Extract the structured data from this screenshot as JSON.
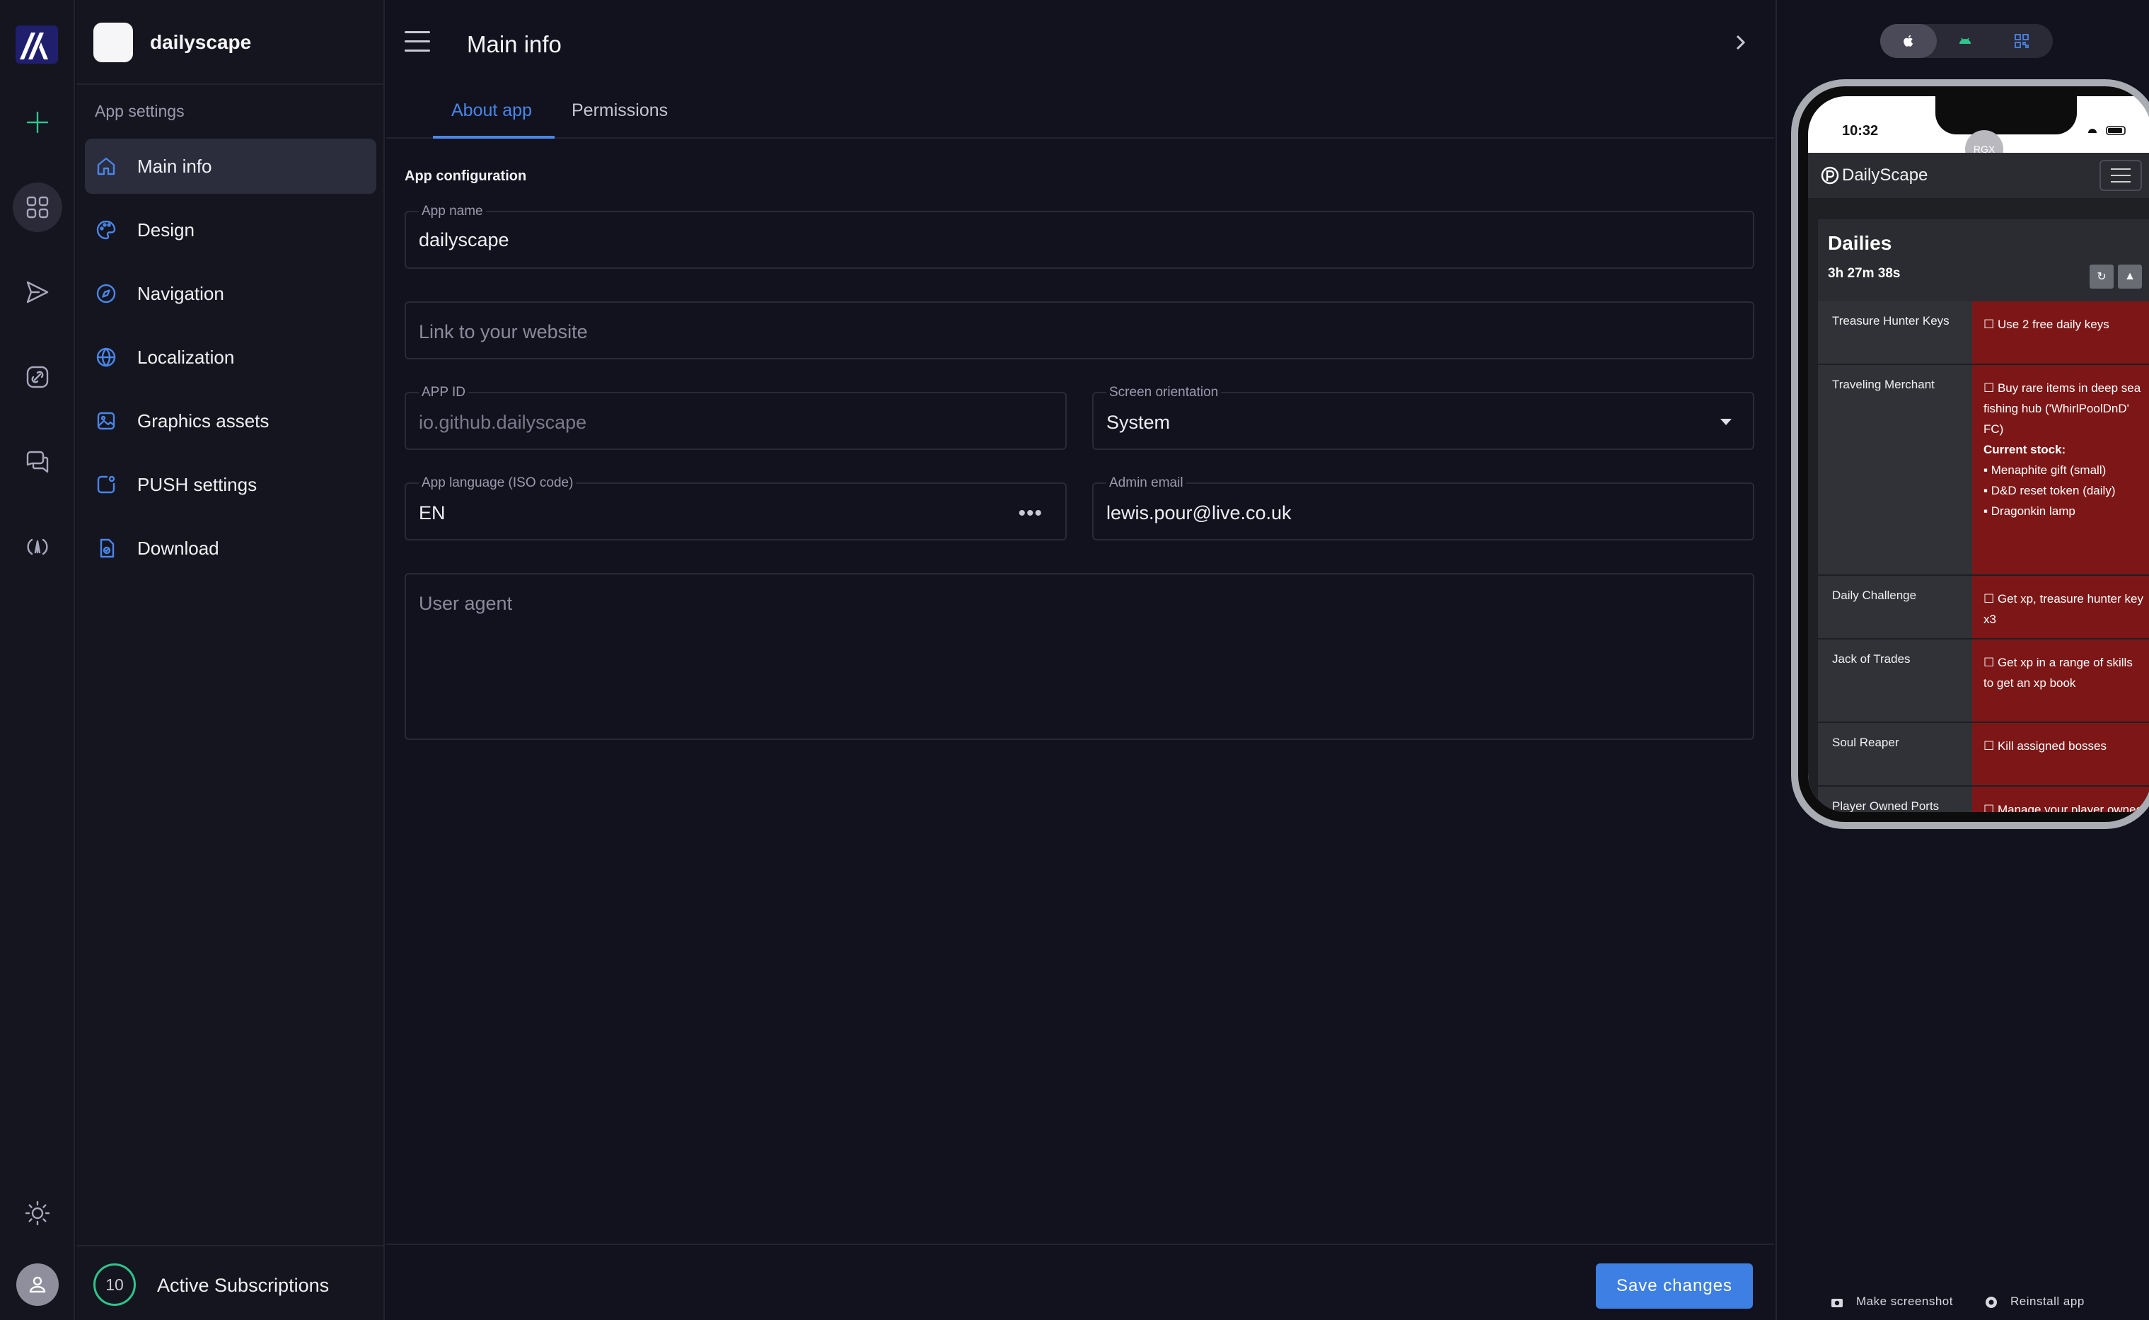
{
  "rail": {
    "icons": [
      "logo",
      "plus-icon",
      "apps-grid-icon",
      "send-icon",
      "link-icon",
      "chat-icon",
      "broadcast-icon",
      "sun-icon",
      "user-icon"
    ]
  },
  "sidebar": {
    "app_name": "dailyscape",
    "section_label": "App settings",
    "items": [
      {
        "label": "Main info",
        "icon": "home-icon",
        "active": true
      },
      {
        "label": "Design",
        "icon": "palette-icon"
      },
      {
        "label": "Navigation",
        "icon": "compass-icon"
      },
      {
        "label": "Localization",
        "icon": "globe-icon"
      },
      {
        "label": "Graphics assets",
        "icon": "image-icon"
      },
      {
        "label": "PUSH settings",
        "icon": "push-icon"
      },
      {
        "label": "Download",
        "icon": "download-icon"
      }
    ],
    "subscriptions": {
      "count": "10",
      "label": "Active Subscriptions"
    }
  },
  "header": {
    "title": "Main info"
  },
  "tabs": [
    {
      "label": "About app",
      "active": true
    },
    {
      "label": "Permissions"
    }
  ],
  "form": {
    "section": "App configuration",
    "app_name": {
      "label": "App name",
      "value": "dailyscape"
    },
    "website": {
      "placeholder": "Link to your website"
    },
    "app_id": {
      "label": "APP ID",
      "value": "io.github.dailyscape"
    },
    "orientation": {
      "label": "Screen orientation",
      "value": "System"
    },
    "language": {
      "label": "App language (ISO code)",
      "value": "EN"
    },
    "admin_email": {
      "label": "Admin email",
      "value": "lewis.pour@live.co.uk"
    },
    "user_agent": {
      "placeholder": "User agent"
    }
  },
  "footer": {
    "save_label": "Save changes"
  },
  "preview": {
    "platforms": [
      "apple-icon",
      "android-icon",
      "qr-icon"
    ],
    "active_platform": "apple",
    "phone": {
      "time": "10:32",
      "bubble": "RGX",
      "site_name": "DailyScape",
      "card_title": "Dailies",
      "timer": "3h 27m 38s",
      "rows": [
        {
          "name": "Treasure Hunter Keys",
          "desc": "☐ Use 2 free daily keys"
        },
        {
          "name": "Traveling Merchant",
          "desc": "☐ Buy rare items in deep sea fishing hub ('WhirlPoolDnD' FC)",
          "stock_label": "Current stock:",
          "stock": [
            "Menaphite gift (small)",
            "D&D reset token (daily)",
            "Dragonkin lamp"
          ]
        },
        {
          "name": "Daily Challenge",
          "desc": "☐ Get xp, treasure hunter key x3"
        },
        {
          "name": "Jack of Trades",
          "desc": "☐ Get xp in a range of skills to get an xp book"
        },
        {
          "name": "Soul Reaper",
          "desc": "☐ Kill assigned bosses"
        },
        {
          "name": "Player Owned Ports",
          "desc": "☐ Manage your player owned port"
        }
      ]
    },
    "actions": {
      "screenshot": "Make screenshot",
      "reinstall": "Reinstall app"
    }
  }
}
